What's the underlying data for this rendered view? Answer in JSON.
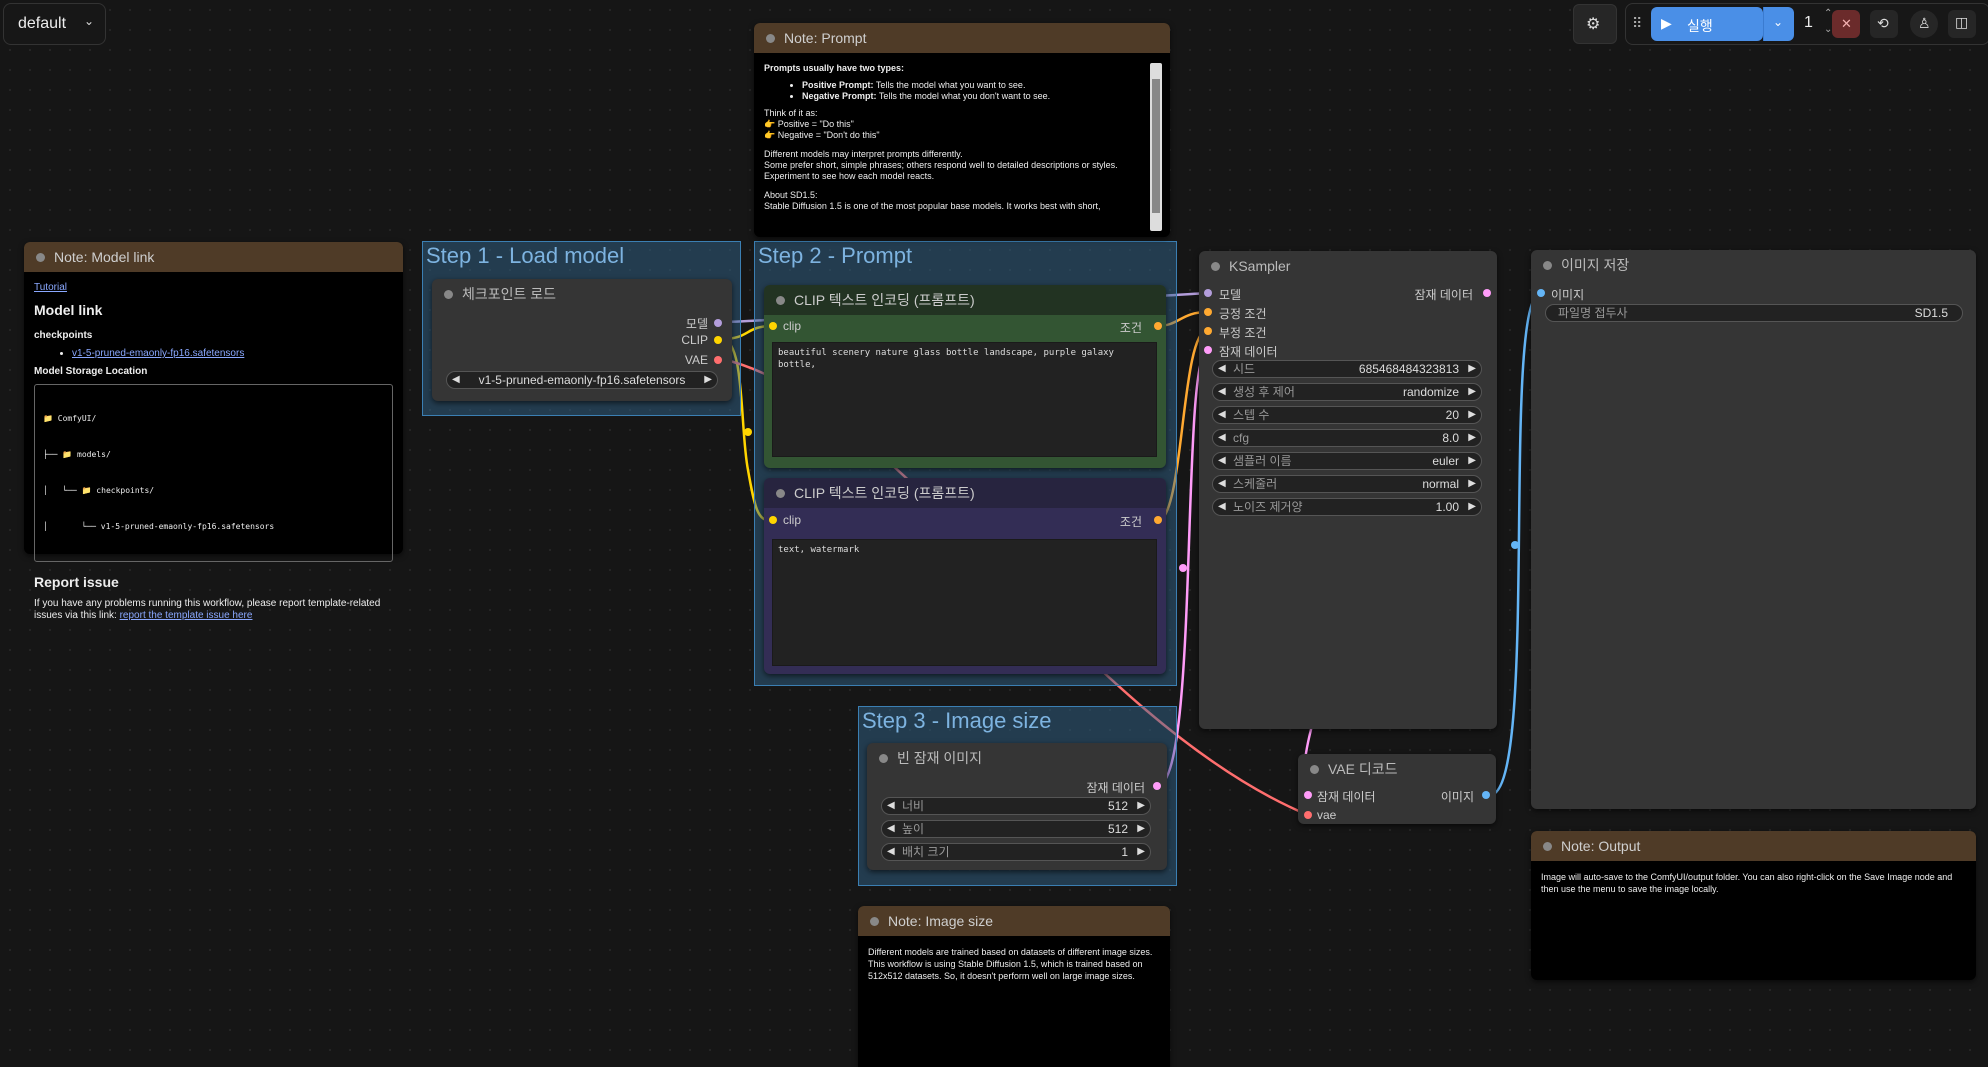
{
  "workspace": {
    "name": "default"
  },
  "toolbar": {
    "run_label": "실행",
    "queue_count": "1"
  },
  "groups": {
    "step1": "Step 1 - Load model",
    "step2": "Step 2 - Prompt",
    "step3": "Step 3 - Image size"
  },
  "note_model": {
    "title": "Note: Model link",
    "tutorial": "Tutorial",
    "heading": "Model link",
    "checkpoints_label": "checkpoints",
    "checkpoint_link": "v1-5-pruned-emaonly-fp16.safetensors",
    "storage_label": "Model Storage Location",
    "tree": [
      "📁 ComfyUI/",
      "├── 📁 models/",
      "│   └── 📁 checkpoints/",
      "│       └── v1-5-pruned-emaonly-fp16.safetensors"
    ],
    "report_heading": "Report issue",
    "report_text": "If you have any problems running this workflow, please report template-related issues via this link:",
    "report_link": "report the template issue here"
  },
  "note_prompt": {
    "title": "Note: Prompt",
    "intro": "Prompts usually have two types:",
    "positive_label": "Positive Prompt:",
    "positive_text": "Tells the model what you want to see.",
    "negative_label": "Negative Prompt:",
    "negative_text": "Tells the model what you don't want to see.",
    "think": "Think of it as:",
    "pos_eq": "👉 Positive = \"Do this\"",
    "neg_eq": "👉 Negative = \"Don't do this\"",
    "para1": "Different models may interpret prompts differently.",
    "para2": "Some prefer short, simple phrases; others respond well to detailed descriptions or styles. Experiment to see how each model reacts.",
    "about": "About SD1.5:",
    "about_text": "Stable Diffusion 1.5 is one of the most popular base models. It works best with short,"
  },
  "ckpt_node": {
    "title": "체크포인트 로드",
    "out_model": "모델",
    "out_clip": "CLIP",
    "out_vae": "VAE",
    "ckpt_name": "v1-5-pruned-emaonly-fp16.safetensors"
  },
  "clip_pos": {
    "title": "CLIP 텍스트 인코딩 (프롬프트)",
    "in_clip": "clip",
    "out_cond": "조건",
    "text": "beautiful scenery nature glass bottle landscape, purple galaxy bottle,"
  },
  "clip_neg": {
    "title": "CLIP 텍스트 인코딩 (프롬프트)",
    "in_clip": "clip",
    "out_cond": "조건",
    "text": "text, watermark"
  },
  "ksampler": {
    "title": "KSampler",
    "in_model": "모델",
    "in_pos": "긍정 조건",
    "in_neg": "부정 조건",
    "in_latent": "잠재 데이터",
    "out_latent": "잠재 데이터",
    "widgets": [
      {
        "label": "시드",
        "value": "685468484323813"
      },
      {
        "label": "생성 후 제어",
        "value": "randomize"
      },
      {
        "label": "스텝 수",
        "value": "20"
      },
      {
        "label": "cfg",
        "value": "8.0"
      },
      {
        "label": "샘플러 이름",
        "value": "euler"
      },
      {
        "label": "스케줄러",
        "value": "normal"
      },
      {
        "label": "노이즈 제거양",
        "value": "1.00"
      }
    ]
  },
  "save_node": {
    "title": "이미지 저장",
    "in_images": "이미지",
    "prefix_label": "파일명 접두사",
    "prefix_value": "SD1.5"
  },
  "empty_latent": {
    "title": "빈 잠재 이미지",
    "out_latent": "잠재 데이터",
    "widgets": [
      {
        "label": "너비",
        "value": "512"
      },
      {
        "label": "높이",
        "value": "512"
      },
      {
        "label": "배치 크기",
        "value": "1"
      }
    ]
  },
  "vae_decode": {
    "title": "VAE 디코드",
    "in_samples": "잠재 데이터",
    "in_vae": "vae",
    "out_image": "이미지"
  },
  "note_output": {
    "title": "Note: Output",
    "text": "Image will auto-save to the ComfyUI/output folder. You can also right-click on the Save Image node and then use the menu to save the image locally."
  },
  "note_size": {
    "title": "Note: Image size",
    "text": "Different models are trained based on datasets of different image sizes. This workflow is using Stable Diffusion 1.5, which is trained based on 512x512 datasets. So, it doesn't perform well on large image sizes."
  },
  "colors": {
    "model": "#b39ddb",
    "clip": "#ffd500",
    "vae": "#ff6e6e",
    "cond": "#ffa931",
    "latent": "#ff9cf9",
    "image": "#64b5f6"
  }
}
